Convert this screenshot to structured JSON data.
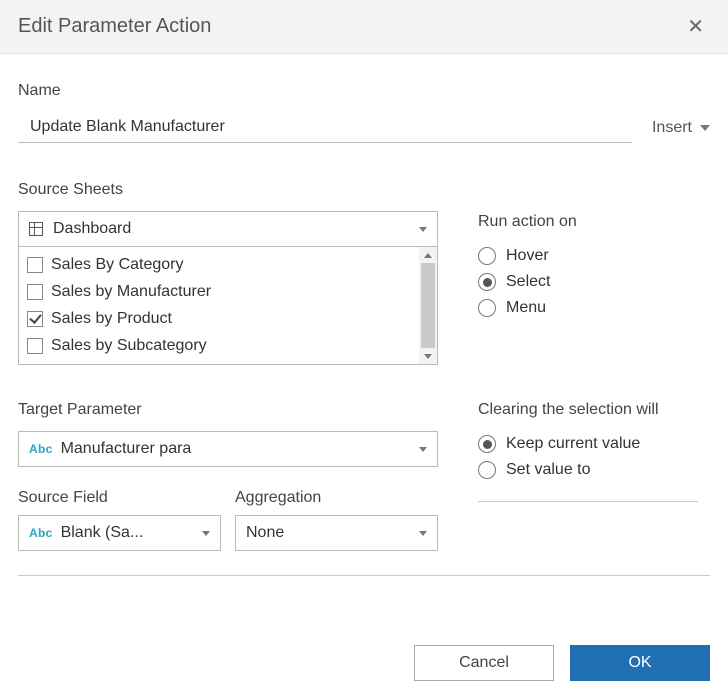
{
  "dialog": {
    "title": "Edit Parameter Action"
  },
  "name": {
    "label": "Name",
    "value": "Update Blank Manufacturer",
    "insert_label": "Insert"
  },
  "source_sheets": {
    "label": "Source Sheets",
    "dropdown_value": "Dashboard",
    "items": [
      {
        "label": "Sales By Category",
        "checked": false
      },
      {
        "label": "Sales by Manufacturer",
        "checked": false
      },
      {
        "label": "Sales by Product",
        "checked": true
      },
      {
        "label": "Sales by Subcategory",
        "checked": false
      }
    ]
  },
  "run_action": {
    "label": "Run action on",
    "options": [
      {
        "label": "Hover",
        "selected": false
      },
      {
        "label": "Select",
        "selected": true
      },
      {
        "label": "Menu",
        "selected": false
      }
    ]
  },
  "target_parameter": {
    "label": "Target Parameter",
    "value": "Manufacturer para",
    "type_badge": "Abc"
  },
  "clearing": {
    "label": "Clearing the selection will",
    "options": [
      {
        "label": "Keep current value",
        "selected": true
      },
      {
        "label": "Set value to",
        "selected": false
      }
    ]
  },
  "source_field": {
    "label": "Source Field",
    "value": "Blank (Sa...",
    "type_badge": "Abc"
  },
  "aggregation": {
    "label": "Aggregation",
    "value": "None"
  },
  "footer": {
    "cancel": "Cancel",
    "ok": "OK"
  }
}
